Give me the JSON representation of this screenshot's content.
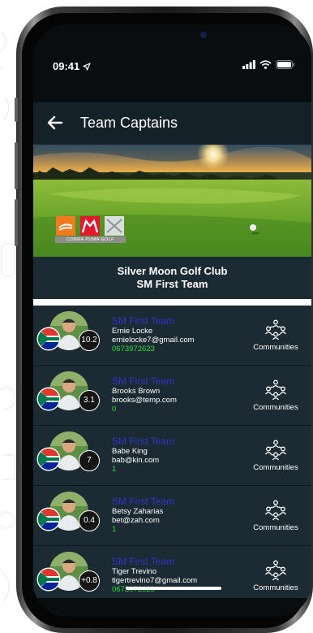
{
  "status_bar": {
    "time": "09:41",
    "icons": [
      "location-arrow-icon",
      "signal-icon",
      "wifi-icon",
      "battery-icon"
    ]
  },
  "header": {
    "title": "Team Captains",
    "back_icon": "arrow-left-icon"
  },
  "hero": {
    "logo_text": "COBRA PUMA GOLF"
  },
  "club": {
    "name": "Silver Moon Golf Club",
    "team": "SM First Team"
  },
  "captains": [
    {
      "team": "SM First Team",
      "name": "Ernie Locke",
      "email": "ernielocke7@gmail.com",
      "phone": "0673972623",
      "handicap": "10.2",
      "communities_label": "Communities"
    },
    {
      "team": "SM First Team",
      "name": "Brooks Brown",
      "email": "brooks@temp.com",
      "phone": "0",
      "handicap": "3.1",
      "communities_label": "Communities"
    },
    {
      "team": "SM First Team",
      "name": "Babe King",
      "email": "bab@kin.com",
      "phone": "1",
      "handicap": "7",
      "communities_label": "Communities"
    },
    {
      "team": "SM First Team",
      "name": "Betsy Zaharias",
      "email": "bet@zah.com",
      "phone": "1",
      "handicap": "0.4",
      "communities_label": "Communities"
    },
    {
      "team": "SM First Team",
      "name": "Tiger Trevino",
      "email": "tigertrevino7@gmail.com",
      "phone": "0673972623",
      "handicap": "+0.8",
      "communities_label": "Communities"
    }
  ],
  "colors": {
    "header_bg": "#152129",
    "row_bg": "#1c2b33",
    "team_link": "#3033c9",
    "phone_green": "#2edb3a"
  }
}
